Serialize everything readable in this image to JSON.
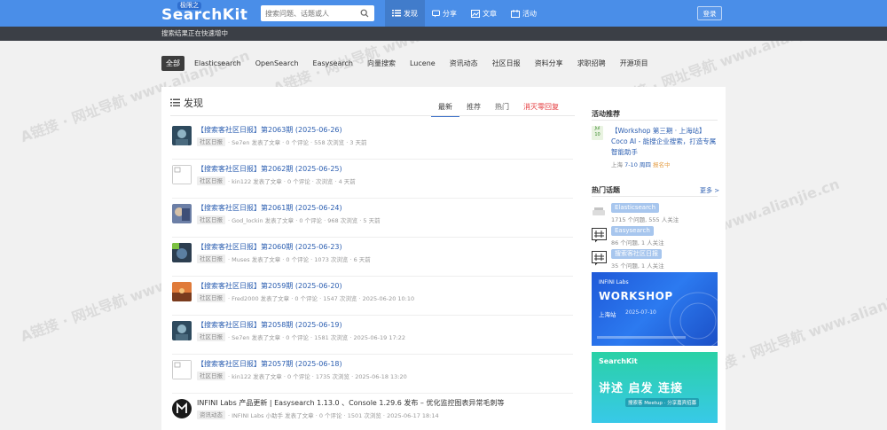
{
  "header": {
    "logo_sub": "极限之",
    "logo_main": "SearchKit",
    "search_placeholder": "搜索问题、话题或人",
    "nav": [
      {
        "label": "发现",
        "icon": "list-icon"
      },
      {
        "label": "分享",
        "icon": "share-icon"
      },
      {
        "label": "文章",
        "icon": "article-icon"
      },
      {
        "label": "活动",
        "icon": "activity-icon"
      }
    ],
    "login_label": "登录"
  },
  "notice": "搜索结果正在快速增中",
  "tags": [
    "全部",
    "Elasticsearch",
    "OpenSearch",
    "Easysearch",
    "向量搜索",
    "Lucene",
    "资讯动态",
    "社区日报",
    "资料分享",
    "求职招聘",
    "开源项目"
  ],
  "main": {
    "heading": "发现",
    "tabs": [
      "最新",
      "推荐",
      "热门",
      "消灭零回复"
    ],
    "articles": [
      {
        "title": "【搜索客社区日报】第2063期 (2025-06-26)",
        "category": "社区日报",
        "meta": "· Se7en 发表了文章 · 0 个评论 · 558 次浏览 · 3 天前"
      },
      {
        "title": "【搜索客社区日报】第2062期 (2025-06-25)",
        "category": "社区日报",
        "meta": "· kin122 发表了文章 · 0 个评论 · 次浏览 · 4 天前"
      },
      {
        "title": "【搜索客社区日报】第2061期 (2025-06-24)",
        "category": "社区日报",
        "meta": "· God_lockin 发表了文章 · 0 个评论 · 968 次浏览 · 5 天前"
      },
      {
        "title": "【搜索客社区日报】第2060期 (2025-06-23)",
        "category": "社区日报",
        "meta": "· Muses 发表了文章 · 0 个评论 · 1073 次浏览 · 6 天前"
      },
      {
        "title": "【搜索客社区日报】第2059期 (2025-06-20)",
        "category": "社区日报",
        "meta": "· Fred2000 发表了文章 · 0 个评论 · 1547 次浏览 · 2025-06-20 10:10"
      },
      {
        "title": "【搜索客社区日报】第2058期 (2025-06-19)",
        "category": "社区日报",
        "meta": "· Se7en 发表了文章 · 0 个评论 · 1581 次浏览 · 2025-06-19 17:22"
      },
      {
        "title": "【搜索客社区日报】第2057期 (2025-06-18)",
        "category": "社区日报",
        "meta": "· kin122 发表了文章 · 0 个评论 · 1735 次浏览 · 2025-06-18 13:20"
      },
      {
        "title": "INFINI Labs 产品更新 | Easysearch 1.13.0 、Console 1.29.6 发布 – 优化监控图表异常毛刺等",
        "category": "资讯动态",
        "meta": "· INFINI Labs 小助手 发表了文章 · 0 个评论 · 1501 次浏览 · 2025-06-17 18:14"
      }
    ]
  },
  "sidebar": {
    "activity_heading": "活动推荐",
    "event": {
      "cal_month": "Jul",
      "cal_day": "10",
      "title": "【Workshop 第三期 · 上海站】Coco AI - 能搜企业搜索，打造专属智能助手",
      "city": "上海",
      "date": "7-10 周四",
      "status": "报名中"
    },
    "topics_heading": "热门话题",
    "more_label": "更多 >",
    "topics": [
      {
        "name": "Elasticsearch",
        "meta": "1715 个问题, 555 人关注"
      },
      {
        "name": "Easysearch",
        "meta": "86 个问题, 1 人关注"
      },
      {
        "name": "搜索客社区日报",
        "meta": "35 个问题, 1 人关注"
      }
    ],
    "banner1": {
      "brand": "INFINI Labs",
      "title": "WORKSHOP",
      "city": "上海站",
      "date": "2025-07-10"
    },
    "banner2": {
      "brand": "SearchKit",
      "title": "讲述 启发 连接",
      "cta": "搜索客 Meetup · 分享嘉宾招募"
    }
  },
  "watermark": "A链接 · 网址导航 www.alianjie.cn",
  "colors": {
    "header": "#4a8ee8",
    "link": "#2a5db0",
    "active_tag": "#3d3d3d",
    "hot_red": "#e4393c"
  }
}
